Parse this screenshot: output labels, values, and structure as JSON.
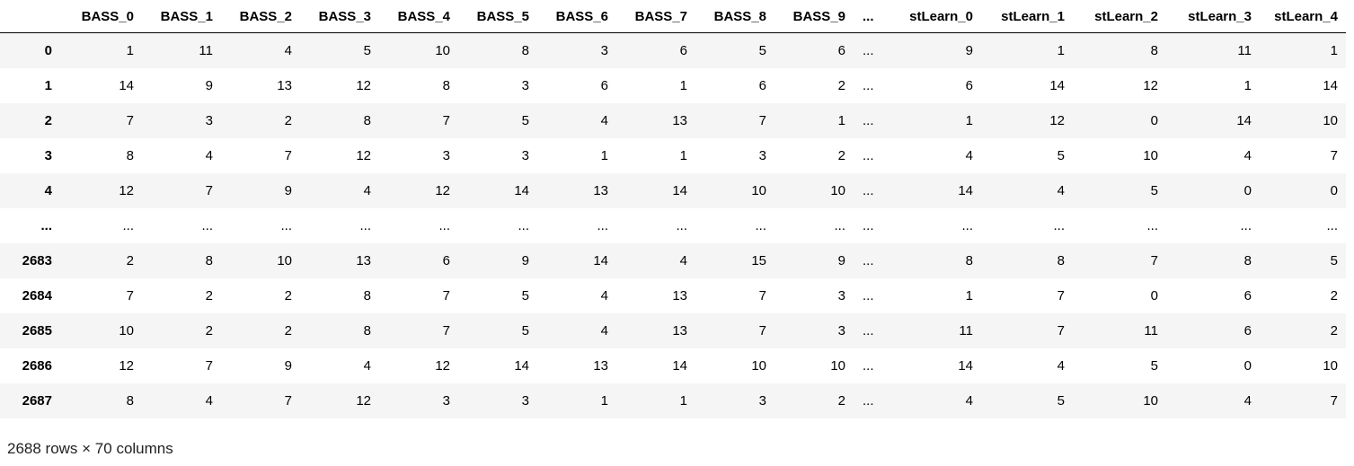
{
  "table": {
    "index_header": "",
    "columns": [
      "BASS_0",
      "BASS_1",
      "BASS_2",
      "BASS_3",
      "BASS_4",
      "BASS_5",
      "BASS_6",
      "BASS_7",
      "BASS_8",
      "BASS_9",
      "...",
      "stLearn_0",
      "stLearn_1",
      "stLearn_2",
      "stLearn_3",
      "stLearn_4"
    ],
    "rows": [
      {
        "index": "0",
        "cells": [
          "1",
          "11",
          "4",
          "5",
          "10",
          "8",
          "3",
          "6",
          "5",
          "6",
          "...",
          "9",
          "1",
          "8",
          "11",
          "1"
        ]
      },
      {
        "index": "1",
        "cells": [
          "14",
          "9",
          "13",
          "12",
          "8",
          "3",
          "6",
          "1",
          "6",
          "2",
          "...",
          "6",
          "14",
          "12",
          "1",
          "14"
        ]
      },
      {
        "index": "2",
        "cells": [
          "7",
          "3",
          "2",
          "8",
          "7",
          "5",
          "4",
          "13",
          "7",
          "1",
          "...",
          "1",
          "12",
          "0",
          "14",
          "10"
        ]
      },
      {
        "index": "3",
        "cells": [
          "8",
          "4",
          "7",
          "12",
          "3",
          "3",
          "1",
          "1",
          "3",
          "2",
          "...",
          "4",
          "5",
          "10",
          "4",
          "7"
        ]
      },
      {
        "index": "4",
        "cells": [
          "12",
          "7",
          "9",
          "4",
          "12",
          "14",
          "13",
          "14",
          "10",
          "10",
          "...",
          "14",
          "4",
          "5",
          "0",
          "0"
        ]
      },
      {
        "index": "...",
        "cells": [
          "...",
          "...",
          "...",
          "...",
          "...",
          "...",
          "...",
          "...",
          "...",
          "...",
          "...",
          "...",
          "...",
          "...",
          "...",
          "..."
        ]
      },
      {
        "index": "2683",
        "cells": [
          "2",
          "8",
          "10",
          "13",
          "6",
          "9",
          "14",
          "4",
          "15",
          "9",
          "...",
          "8",
          "8",
          "7",
          "8",
          "5"
        ]
      },
      {
        "index": "2684",
        "cells": [
          "7",
          "2",
          "2",
          "8",
          "7",
          "5",
          "4",
          "13",
          "7",
          "3",
          "...",
          "1",
          "7",
          "0",
          "6",
          "2"
        ]
      },
      {
        "index": "2685",
        "cells": [
          "10",
          "2",
          "2",
          "8",
          "7",
          "5",
          "4",
          "13",
          "7",
          "3",
          "...",
          "11",
          "7",
          "11",
          "6",
          "2"
        ]
      },
      {
        "index": "2686",
        "cells": [
          "12",
          "7",
          "9",
          "4",
          "12",
          "14",
          "13",
          "14",
          "10",
          "10",
          "...",
          "14",
          "4",
          "5",
          "0",
          "10"
        ]
      },
      {
        "index": "2687",
        "cells": [
          "8",
          "4",
          "7",
          "12",
          "3",
          "3",
          "1",
          "1",
          "3",
          "2",
          "...",
          "4",
          "5",
          "10",
          "4",
          "7"
        ]
      }
    ]
  },
  "shape_text": "2688 rows × 70 columns"
}
